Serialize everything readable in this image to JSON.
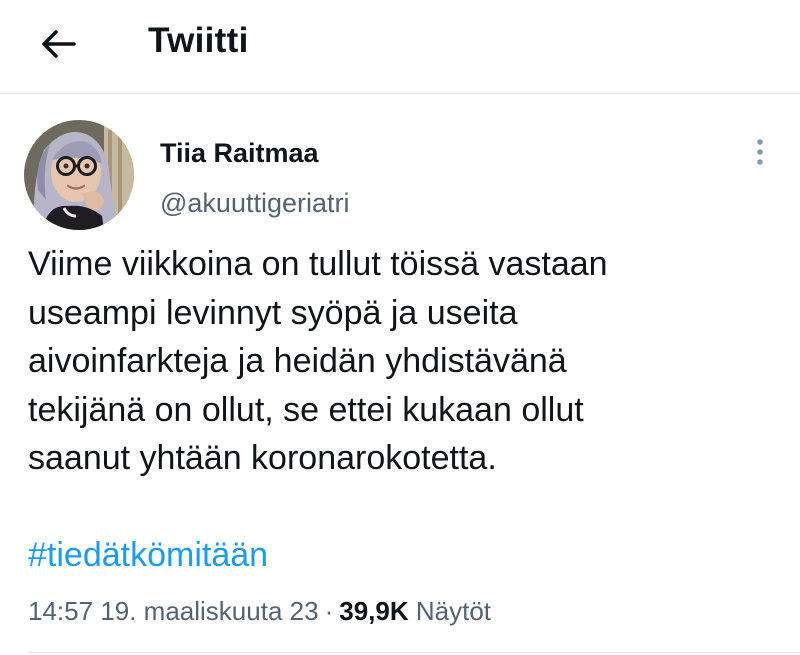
{
  "header": {
    "title": "Twiitti",
    "back_icon": "arrow-left-icon"
  },
  "tweet": {
    "author_name": "Tiia Raitmaa",
    "author_handle": "@akuuttigeriatri",
    "text": "Viime viikkoina on tullut töissä vastaan\nuseampi levinnyt syöpä ja useita\naivoinfarkteja ja heidän yhdistävänä\ntekijänä on ollut, se ettei kukaan ollut\nsaanut yhtään koronarokotetta.",
    "hashtag": "#tiedätkömitään",
    "time": "14:57",
    "date": "19. maaliskuuta 23",
    "separator": "·",
    "views_count": "39,9K",
    "views_label": "Näytöt",
    "more_icon": "more-vertical-icon"
  },
  "colors": {
    "text": "#0f1419",
    "secondary": "#536471",
    "link": "#1d9bf0",
    "divider": "#e6e9eb"
  }
}
